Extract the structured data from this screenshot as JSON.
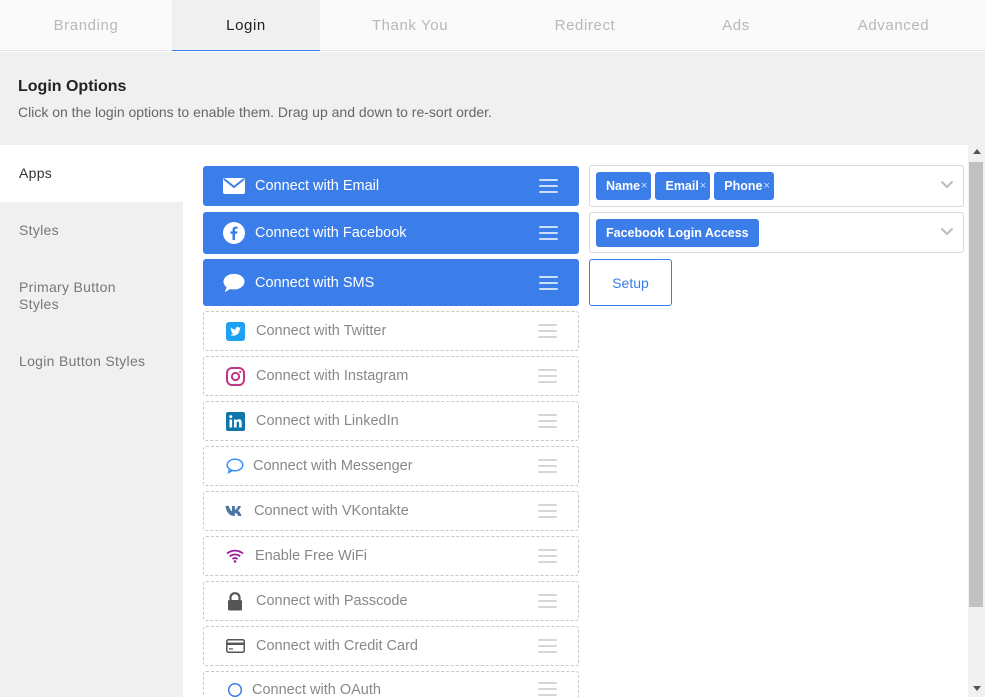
{
  "tabs": [
    {
      "label": "Branding",
      "active": false
    },
    {
      "label": "Login",
      "active": true
    },
    {
      "label": "Thank You",
      "active": false
    },
    {
      "label": "Redirect",
      "active": false
    },
    {
      "label": "Ads",
      "active": false
    },
    {
      "label": "Advanced",
      "active": false
    }
  ],
  "options": {
    "title": "Login Options",
    "description": "Click on the login options to enable them. Drag up and down to re-sort order."
  },
  "side_menu": [
    {
      "label": "Apps",
      "active": true
    },
    {
      "label": "Styles",
      "active": false
    },
    {
      "label": "Primary Button Styles",
      "active": false
    },
    {
      "label": "Login Button Styles",
      "active": false
    }
  ],
  "apps": [
    {
      "label": "Connect with Email",
      "icon": "envelope-icon",
      "enabled": true
    },
    {
      "label": "Connect with Facebook",
      "icon": "facebook-icon",
      "enabled": true
    },
    {
      "label": "Connect with SMS",
      "icon": "chat-bubble-icon",
      "enabled": true
    },
    {
      "label": "Connect with Twitter",
      "icon": "twitter-icon",
      "enabled": false
    },
    {
      "label": "Connect with Instagram",
      "icon": "instagram-icon",
      "enabled": false
    },
    {
      "label": "Connect with LinkedIn",
      "icon": "linkedin-icon",
      "enabled": false
    },
    {
      "label": "Connect with Messenger",
      "icon": "messenger-icon",
      "enabled": false
    },
    {
      "label": "Connect with VKontakte",
      "icon": "vk-icon",
      "enabled": false
    },
    {
      "label": "Enable Free WiFi",
      "icon": "wifi-icon",
      "enabled": false
    },
    {
      "label": "Connect with Passcode",
      "icon": "lock-icon",
      "enabled": false
    },
    {
      "label": "Connect with Credit Card",
      "icon": "credit-card-icon",
      "enabled": false
    },
    {
      "label": "Connect with OAuth",
      "icon": "oauth-icon",
      "enabled": false
    }
  ],
  "email_fields": {
    "chips": [
      {
        "label": "Name",
        "remove": "×"
      },
      {
        "label": "Email",
        "remove": "×"
      },
      {
        "label": "Phone",
        "remove": "×"
      }
    ]
  },
  "facebook_fields": {
    "chips": [
      {
        "label": "Facebook Login Access"
      }
    ]
  },
  "sms": {
    "setup_label": "Setup"
  },
  "colors": {
    "accent": "#3b7de9",
    "facebook": "#3b5998",
    "twitter": "#1da1f2",
    "instagram": "#c13584",
    "linkedin": "#0e76a8",
    "messenger": "#2d8cff",
    "vk": "#4c75a3",
    "wifi": "#9b1b9b",
    "neutral_icon": "#555555"
  }
}
